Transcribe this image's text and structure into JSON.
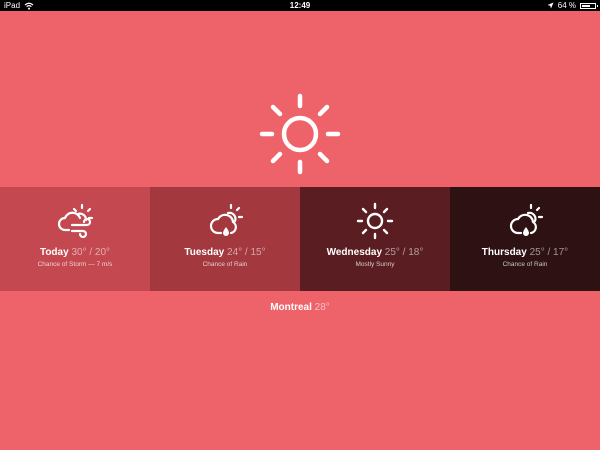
{
  "status_bar": {
    "device": "iPad",
    "time": "12:49",
    "battery": "64 %",
    "battery_level": 0.64,
    "icons": [
      "wifi-icon",
      "location-arrow-icon",
      "battery-icon"
    ]
  },
  "current": {
    "icon": "sun-icon"
  },
  "forecast": [
    {
      "day": "Today",
      "temps": "30° / 20°",
      "condition": "Chance of Storm — 7 m/s",
      "icon": "cloud-sun-wind-icon"
    },
    {
      "day": "Tuesday",
      "temps": "24° / 15°",
      "condition": "Chance of Rain",
      "icon": "cloud-sun-rain-icon"
    },
    {
      "day": "Wednesday",
      "temps": "25° / 18°",
      "condition": "Mostly Sunny",
      "icon": "sun-icon"
    },
    {
      "day": "Thursday",
      "temps": "25° / 17°",
      "condition": "Chance of Rain",
      "icon": "cloud-sun-rain-icon"
    }
  ],
  "location": {
    "city": "Montreal",
    "temp": "28°"
  },
  "colors": {
    "background": "#ee6269",
    "day_tiles": [
      "#c4484f",
      "#a3383f",
      "#5a1e22",
      "#2d1113"
    ],
    "foreground": "#ffffff"
  }
}
